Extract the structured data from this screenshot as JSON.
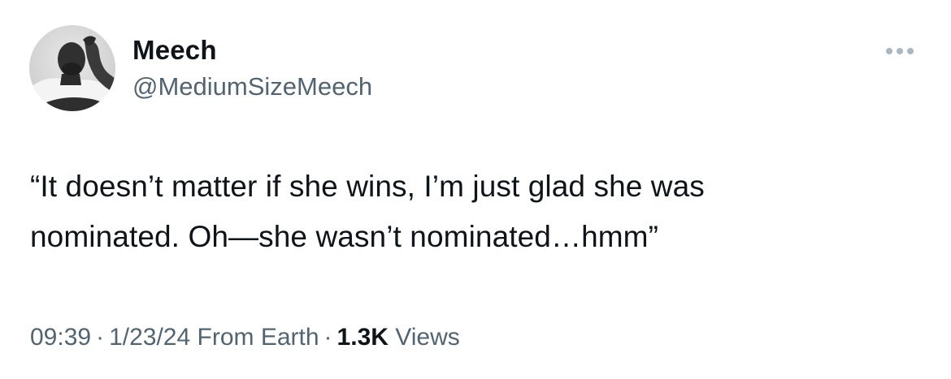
{
  "author": {
    "display_name": "Meech",
    "handle": "@MediumSizeMeech",
    "avatar_icon": "user-avatar-photo"
  },
  "more_icon": "ellipsis-icon",
  "tweet": {
    "text_lines": [
      "“It doesn’t matter if she wins, I’m just glad she was",
      "nominated. Oh—she wasn’t nominated…hmm”"
    ]
  },
  "meta": {
    "time": "09:39",
    "separator": "·",
    "date": "1/23/24",
    "location": "From Earth",
    "views_count": "1.3K",
    "views_label": "Views"
  },
  "colors": {
    "text_primary": "#0f1419",
    "text_secondary": "#536471",
    "more_dots": "#aab8c2",
    "background": "#ffffff"
  }
}
